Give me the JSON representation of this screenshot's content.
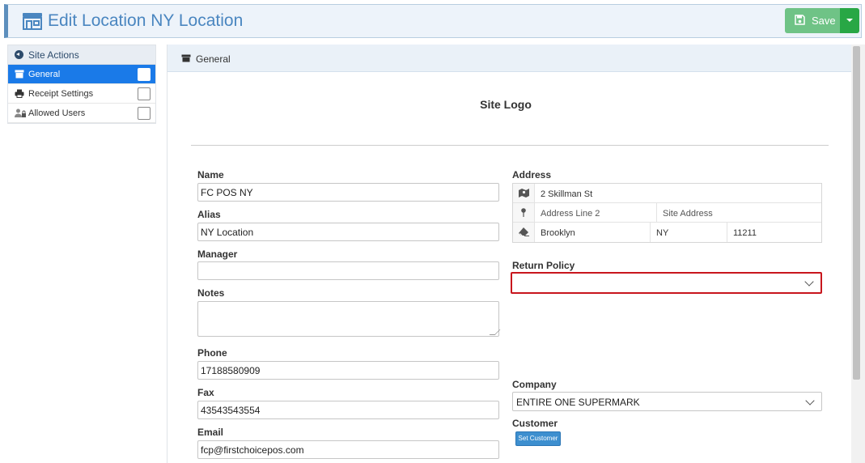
{
  "header": {
    "title": "Edit Location NY Location",
    "save_label": "Save"
  },
  "sidebar": {
    "header_label": "Site Actions",
    "items": [
      {
        "label": "General",
        "active": true
      },
      {
        "label": "Receipt Settings",
        "active": false
      },
      {
        "label": "Allowed Users",
        "active": false
      }
    ]
  },
  "panel": {
    "title": "General",
    "site_logo_label": "Site Logo"
  },
  "form": {
    "name": {
      "label": "Name",
      "value": "FC POS NY"
    },
    "alias": {
      "label": "Alias",
      "value": "NY Location"
    },
    "manager": {
      "label": "Manager",
      "value": ""
    },
    "notes": {
      "label": "Notes",
      "value": ""
    },
    "phone": {
      "label": "Phone",
      "value": "17188580909"
    },
    "fax": {
      "label": "Fax",
      "value": "43543543554"
    },
    "email": {
      "label": "Email",
      "value": "fcp@firstchoicepos.com"
    },
    "address": {
      "label": "Address",
      "line1": "2 Skillman St",
      "line2_placeholder": "Address Line 2",
      "site_address_placeholder": "Site Address",
      "city": "Brooklyn",
      "state": "NY",
      "zip": "11211"
    },
    "return_policy": {
      "label": "Return Policy",
      "value": ""
    },
    "company": {
      "label": "Company",
      "value": "ENTIRE ONE SUPERMARK"
    },
    "customer": {
      "label": "Customer",
      "button_label": "Set Customer"
    }
  },
  "colors": {
    "accent": "#4a86c0",
    "active_nav": "#1a7ae8",
    "save": "#6fc386",
    "save_caret": "#28a745",
    "error_border": "#c8161d",
    "small_button": "#3d8fcf"
  },
  "icons": [
    "store-icon",
    "floppy-icon",
    "chevron-down-icon",
    "arrow-left-circle-icon",
    "printer-icon",
    "user-lock-icon",
    "map-icon",
    "pin-icon",
    "eraser-icon"
  ]
}
